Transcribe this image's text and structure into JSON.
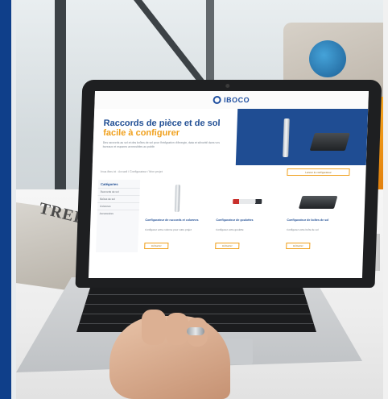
{
  "photo": {
    "magazine_title": "TREE",
    "brand_band_color": "#0f3f8a"
  },
  "site": {
    "logo_text": "IBOCO",
    "hero": {
      "title_line1": "Raccords de pièce et de sol",
      "title_line2": "facile à configurer",
      "body": "Des raccords au sol et des boîtes de sol pour l'intégration d'énergie, data et sécurité dans vos bureaux et espaces accessibles au public"
    },
    "breadcrumb": "Vous êtes ici : Accueil / Configurateur / Mon projet",
    "cta_label": "Lancer le configurateur",
    "filters": {
      "title": "Catégories",
      "items": [
        "Raccords de sol",
        "Boîtes de sol",
        "Colonnes",
        "Accessoires"
      ]
    },
    "products": [
      {
        "name": "Configurateur de raccords et colonnes",
        "desc": "Configurez votre colonne pour votre projet",
        "button": "Démarrer"
      },
      {
        "name": "Configurateur de goulottes",
        "desc": "Configurez votre goulotte",
        "button": "Démarrer"
      },
      {
        "name": "Configurateur de boîtes de sol",
        "desc": "Configurez votre boîte de sol",
        "button": "Démarrer"
      }
    ]
  }
}
